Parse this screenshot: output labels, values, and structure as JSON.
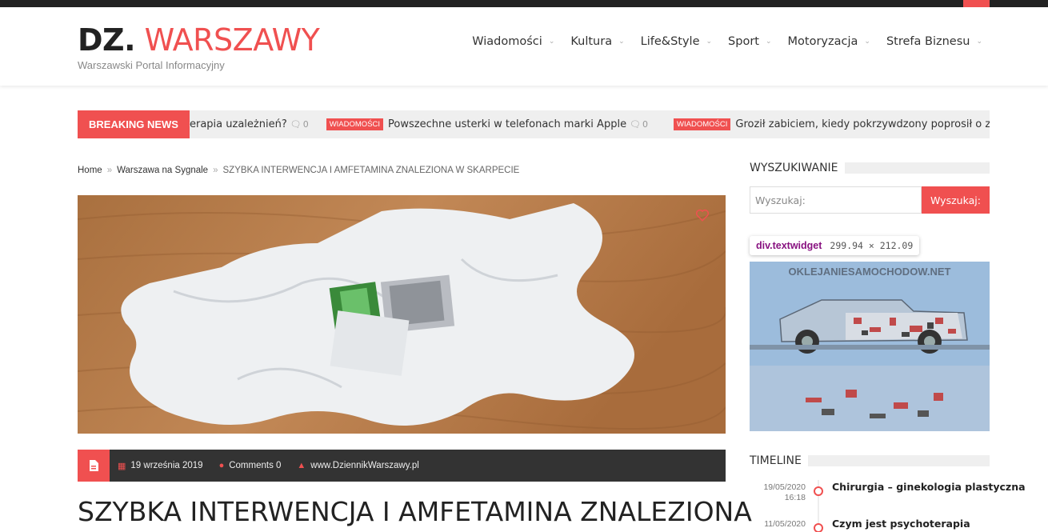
{
  "site": {
    "logo_part1": "DZ.",
    "logo_part2": "WARSZAWY",
    "tagline": "Warszawski Portal Informacyjny"
  },
  "nav": {
    "items": [
      {
        "label": "Wiadomości"
      },
      {
        "label": "Kultura"
      },
      {
        "label": "Life&Style"
      },
      {
        "label": "Sport"
      },
      {
        "label": "Motoryzacja"
      },
      {
        "label": "Strefa Biznesu"
      }
    ],
    "chevron": "⌄"
  },
  "ticker": {
    "label": "BREAKING NEWS",
    "items": [
      {
        "category": "",
        "title": "erapia uzależnień?",
        "comments": "0"
      },
      {
        "category": "WIADOMOŚCI",
        "title": "Powszechne usterki w telefonach marki Apple",
        "comments": "0"
      },
      {
        "category": "WIADOMOŚCI",
        "title": "Groził zabiciem, kiedy pokrzywdzony poprosił o zwrot pożyczki",
        "comments": ""
      }
    ]
  },
  "breadcrumb": {
    "home": "Home",
    "section": "Warszawa na Sygnale",
    "current": "SZYBKA INTERWENCJA I AMFETAMINA ZNALEZIONA W SKARPECIE",
    "sep": "»"
  },
  "post": {
    "date": "19 września 2019",
    "comments": "Comments 0",
    "author": "www.DziennikWarszawy.pl",
    "title": "SZYBKA INTERWENCJA I AMFETAMINA ZNALEZIONA"
  },
  "sidebar": {
    "search_title": "WYSZUKIWANIE",
    "search_placeholder": "Wyszukaj:",
    "search_button": "Wyszukaj:",
    "ad_text": "OKLEJANIESAMOCHODOW.NET",
    "timeline_title": "TIMELINE",
    "timeline": [
      {
        "date": "19/05/2020",
        "time": "16:18",
        "title": "Chirurgia – ginekologia plastyczna"
      },
      {
        "date": "11/05/2020",
        "time": "",
        "title": "Czym jest psychoterapia"
      }
    ]
  },
  "devtools_tooltip": {
    "name": "div.textwidget",
    "dims": "299.94 × 212.09"
  },
  "colors": {
    "accent": "#f05050",
    "dark": "#333333"
  }
}
